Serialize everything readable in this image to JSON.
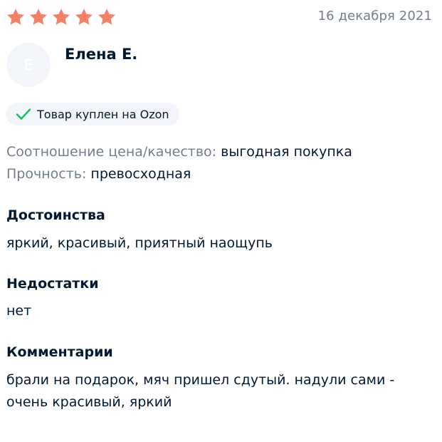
{
  "rating": {
    "value": 5,
    "max": 5,
    "star_color": "#f57f6b"
  },
  "date": "16 декабря 2021",
  "author": {
    "avatar_letter": "Е",
    "name": "Елена Е."
  },
  "badge": {
    "icon": "check-icon",
    "label": "Товар куплен на Ozon",
    "icon_color": "#10c44c"
  },
  "attributes": [
    {
      "key": "Соотношение цена/качество:",
      "value": "выгодная покупка"
    },
    {
      "key": "Прочность:",
      "value": "превосходная"
    }
  ],
  "sections": {
    "pros": {
      "title": "Достоинства",
      "text": "яркий, красивый, приятный наощупь"
    },
    "cons": {
      "title": "Недостатки",
      "text": "нет"
    },
    "comment": {
      "title": "Комментарии",
      "line1": "брали на подарок, мяч пришел сдутый. надули сами -",
      "line2": "очень красивый, яркий"
    }
  }
}
